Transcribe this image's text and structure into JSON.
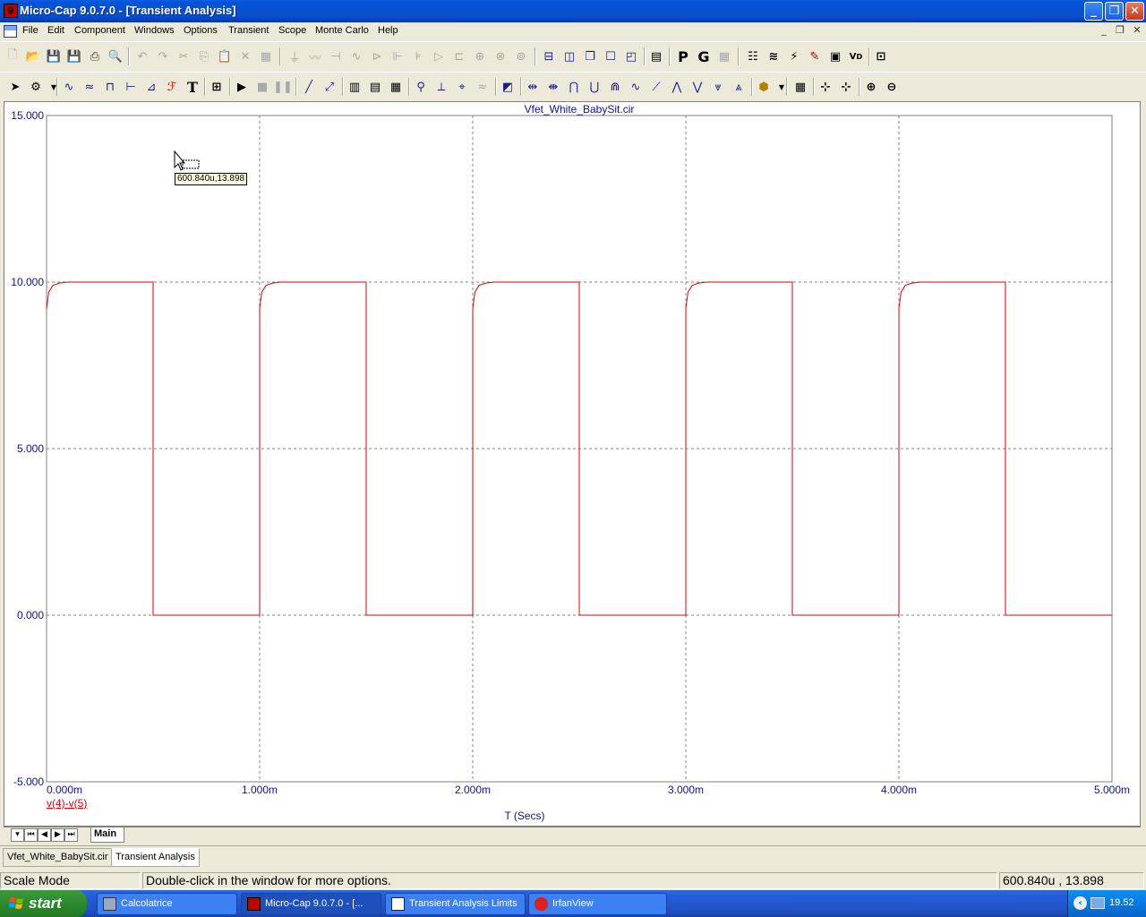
{
  "window": {
    "title": "Micro-Cap 9.0.7.0 - [Transient Analysis]"
  },
  "menu": [
    "File",
    "Edit",
    "Component",
    "Windows",
    "Options",
    "Transient",
    "Scope",
    "Monte Carlo",
    "Help"
  ],
  "plot": {
    "title": "Vfet_White_BabySit.cir",
    "trace_label": "v(4)-v(5)",
    "trace_color": "#e00000",
    "axis_color": "#1010a0",
    "tooltip": "600.840u,13.898"
  },
  "chart_data": {
    "type": "line",
    "title": "Vfet_White_BabySit.cir",
    "xlabel": "T (Secs)",
    "ylabel": "",
    "xlim": [
      0,
      0.005
    ],
    "ylim": [
      -5,
      15
    ],
    "x_ticks": [
      0,
      0.001,
      0.002,
      0.003,
      0.004,
      0.005
    ],
    "x_tick_labels": [
      "0.000m",
      "1.000m",
      "2.000m",
      "3.000m",
      "4.000m",
      "5.000m"
    ],
    "y_ticks": [
      15,
      10,
      5,
      0,
      -5
    ],
    "y_tick_labels": [
      "15.000",
      "10.000",
      "5.000",
      "0.000",
      "-5.000"
    ],
    "grid": true,
    "series": [
      {
        "name": "v(4)-v(5)",
        "color": "#e00000",
        "x": [
          0,
          1e-05,
          3e-05,
          6e-05,
          0.0001,
          0.0005,
          0.0005,
          0.001,
          0.001,
          0.00101,
          0.00103,
          0.00106,
          0.0011,
          0.0015,
          0.0015,
          0.002,
          0.002,
          0.00201,
          0.00203,
          0.00206,
          0.0021,
          0.0025,
          0.0025,
          0.003,
          0.003,
          0.00301,
          0.00303,
          0.00306,
          0.0031,
          0.0035,
          0.0035,
          0.004,
          0.004,
          0.00401,
          0.00403,
          0.00406,
          0.0041,
          0.0045,
          0.0045,
          0.005
        ],
        "y": [
          9.2,
          9.7,
          9.9,
          9.97,
          10,
          10,
          0,
          0,
          9.2,
          9.7,
          9.9,
          9.97,
          10,
          10,
          0,
          0,
          9.2,
          9.7,
          9.9,
          9.97,
          10,
          10,
          0,
          0,
          9.2,
          9.7,
          9.9,
          9.97,
          10,
          10,
          0,
          0,
          9.2,
          9.7,
          9.9,
          9.97,
          10,
          10,
          0,
          0
        ]
      }
    ]
  },
  "page_tab": "Main",
  "doc_tabs": [
    "Vfet_White_BabySit.cir",
    "Transient Analysis"
  ],
  "status": {
    "mode": "Scale Mode",
    "hint": "Double-click in the window for more options.",
    "coords": "600.840u , 13.898"
  },
  "taskbar": {
    "start": "start",
    "tasks": [
      "Calcolatrice",
      "Micro-Cap 9.0.7.0 - [...",
      "Transient Analysis Limits",
      "IrfanView"
    ],
    "clock": "19.52"
  }
}
